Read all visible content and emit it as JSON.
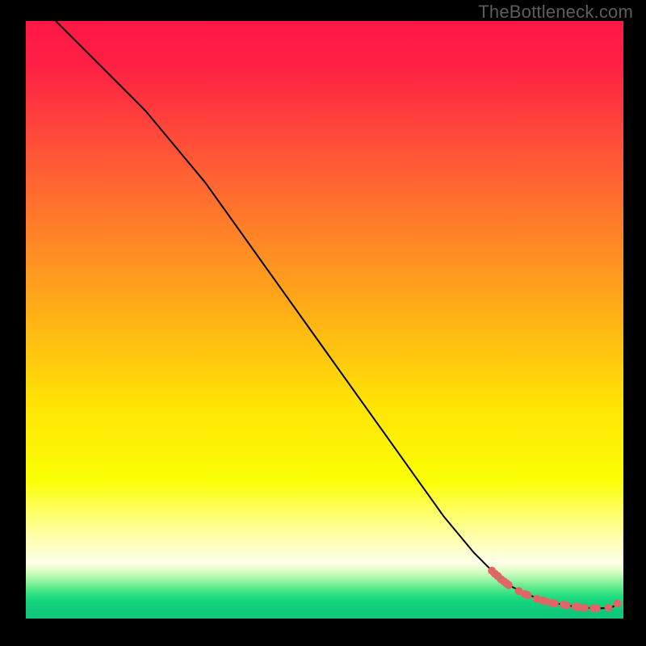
{
  "watermark": "TheBottleneck.com",
  "chart_data": {
    "type": "line",
    "title": "",
    "xlabel": "",
    "ylabel": "",
    "xlim": [
      0,
      100
    ],
    "ylim": [
      0,
      100
    ],
    "grid": false,
    "background_gradient": {
      "stops": [
        {
          "offset": 0.0,
          "color": "#ff1846"
        },
        {
          "offset": 0.07,
          "color": "#ff1f44"
        },
        {
          "offset": 0.2,
          "color": "#ff4d3a"
        },
        {
          "offset": 0.35,
          "color": "#ff8028"
        },
        {
          "offset": 0.5,
          "color": "#ffb315"
        },
        {
          "offset": 0.65,
          "color": "#ffe605"
        },
        {
          "offset": 0.77,
          "color": "#fbff05"
        },
        {
          "offset": 0.83,
          "color": "#ffff74"
        },
        {
          "offset": 0.87,
          "color": "#ffffb6"
        },
        {
          "offset": 0.906,
          "color": "#ffffe8"
        },
        {
          "offset": 0.918,
          "color": "#e4ffcb"
        },
        {
          "offset": 0.932,
          "color": "#a9f7ab"
        },
        {
          "offset": 0.948,
          "color": "#5fea8d"
        },
        {
          "offset": 0.962,
          "color": "#25de80"
        },
        {
          "offset": 0.974,
          "color": "#12d37d"
        },
        {
          "offset": 0.986,
          "color": "#0fc97b"
        },
        {
          "offset": 1.0,
          "color": "#0fc77a"
        }
      ]
    },
    "series": [
      {
        "name": "bottleneck-curve",
        "color": "#000000",
        "x": [
          5,
          10,
          15,
          20,
          25,
          30,
          35,
          40,
          45,
          50,
          55,
          60,
          65,
          70,
          75,
          78,
          80,
          82,
          84,
          86,
          88,
          90,
          92,
          94,
          96,
          98,
          99
        ],
        "y": [
          100,
          95,
          90,
          85,
          79,
          73,
          66,
          59,
          52,
          45,
          38,
          31,
          24,
          17,
          11,
          8,
          6,
          5,
          4,
          3.3,
          2.7,
          2.3,
          2.0,
          1.8,
          1.7,
          1.8,
          2.5
        ]
      }
    ],
    "points": {
      "name": "marked-range",
      "color": "#e06666",
      "radius": 5,
      "x": [
        78.0,
        78.5,
        79.0,
        79.5,
        80.0,
        80.4,
        80.8,
        82.5,
        83.5,
        84.0,
        85.5,
        86.5,
        87.0,
        88.0,
        88.5,
        90.0,
        90.5,
        92.0,
        92.5,
        93.5,
        95.0,
        95.5,
        97.5,
        99.0
      ],
      "y": [
        8.0,
        7.5,
        7.1,
        6.6,
        6.2,
        5.9,
        5.6,
        4.6,
        4.1,
        3.9,
        3.3,
        3.0,
        2.9,
        2.6,
        2.5,
        2.3,
        2.2,
        2.0,
        1.9,
        1.8,
        1.7,
        1.7,
        1.8,
        2.5
      ]
    }
  }
}
